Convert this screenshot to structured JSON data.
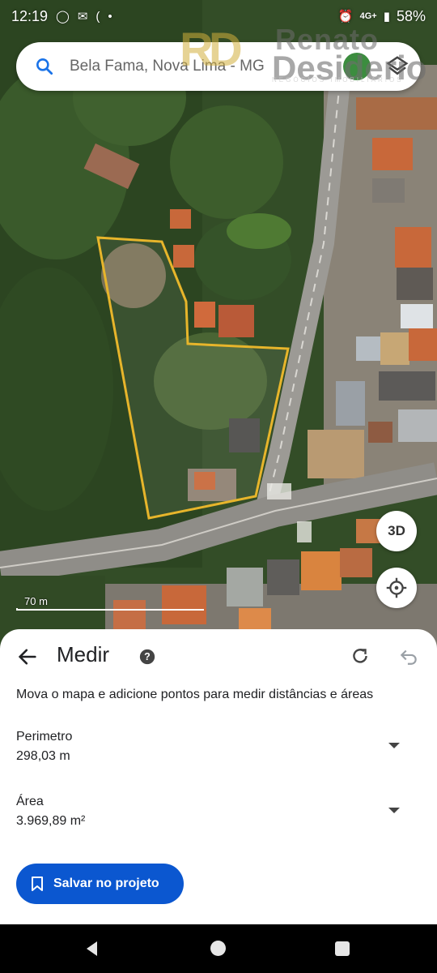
{
  "status_bar": {
    "time": "12:19",
    "network": "4G+",
    "battery": "58%"
  },
  "search": {
    "placeholder": "Bela Fama, Nova Lima - MG"
  },
  "watermark": {
    "logo": "RD",
    "name_line1": "Renato",
    "name_line2": "Desiderio",
    "tagline": "NEGÓCIOS IMOBILIÁRIOS"
  },
  "map": {
    "button_3d": "3D",
    "scale_label": "70 m",
    "polygon_color": "#e7b52b"
  },
  "measure": {
    "title": "Medir",
    "description": "Mova o mapa e adicione pontos para medir distâncias e áreas",
    "perimeter_label": "Perimetro",
    "perimeter_value": "298,03 m",
    "area_label": "Área",
    "area_value": "3.969,89 m²",
    "save_button": "Salvar no projeto"
  },
  "colors": {
    "accent": "#0b57d0",
    "sheet_bg": "#ffffff"
  },
  "icons": [
    "whatsapp-icon",
    "mail-icon",
    "alarm-icon",
    "battery-icon",
    "search-icon",
    "layers-icon",
    "location-icon",
    "back-arrow-icon",
    "help-icon",
    "redo-icon",
    "undo-icon",
    "bookmark-icon"
  ]
}
